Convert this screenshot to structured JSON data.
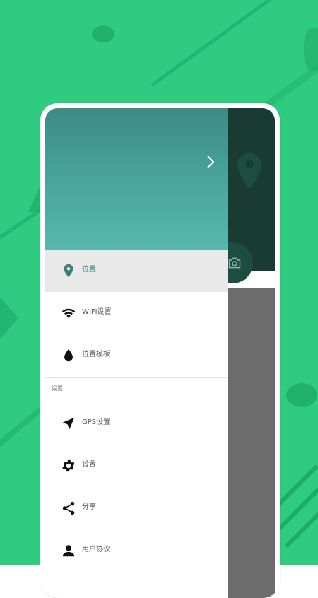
{
  "drawer": {
    "items": [
      {
        "label": "位置",
        "icon": "location-pin-icon",
        "active": true
      },
      {
        "label": "WIFI设置",
        "icon": "wifi-icon",
        "active": false
      },
      {
        "label": "位置模板",
        "icon": "water-drop-icon",
        "active": false
      }
    ],
    "section_title": "设置",
    "settings_items": [
      {
        "label": "GPS设置",
        "icon": "navigation-arrow-icon"
      },
      {
        "label": "设置",
        "icon": "gear-icon"
      },
      {
        "label": "分享",
        "icon": "share-icon"
      },
      {
        "label": "用户协议",
        "icon": "user-icon"
      }
    ]
  },
  "colors": {
    "background": "#2ecb80",
    "header_gradient_start": "#3b8b84",
    "header_gradient_end": "#58b7ae",
    "active_item_bg": "#e9e9e9",
    "active_accent": "#3a7f77"
  }
}
